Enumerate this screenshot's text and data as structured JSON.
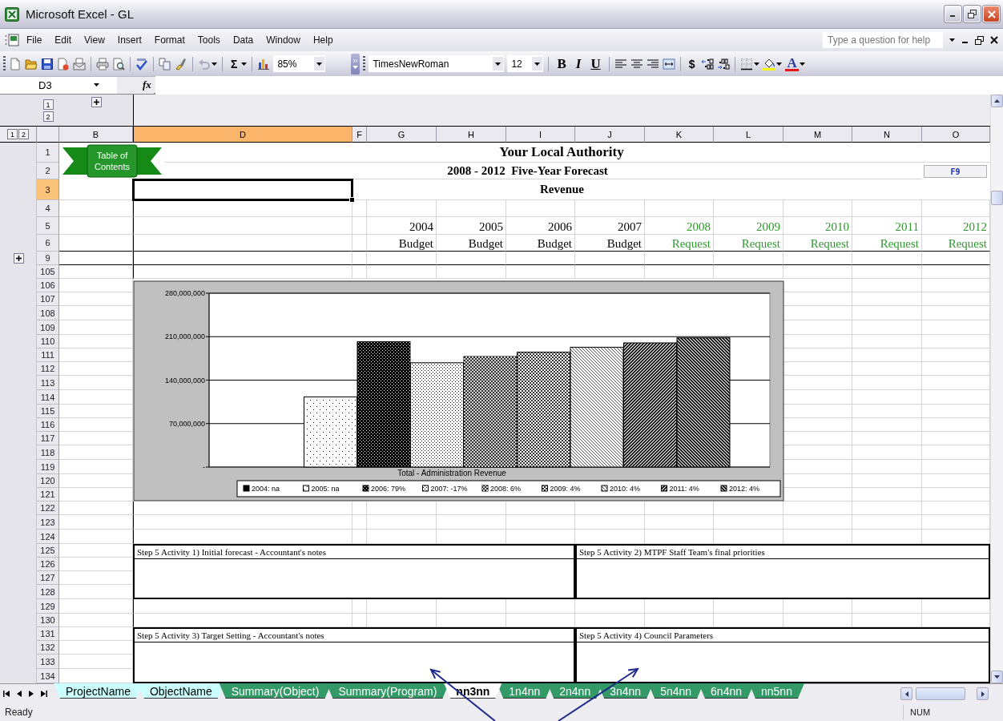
{
  "window": {
    "title": "Microsoft Excel - GL"
  },
  "menu": [
    "File",
    "Edit",
    "View",
    "Insert",
    "Format",
    "Tools",
    "Data",
    "Window",
    "Help"
  ],
  "help_box": {
    "placeholder": "Type a question for help"
  },
  "toolbar": {
    "zoom": "85%",
    "autosum": "Σ",
    "font": "TimesNewRoman",
    "size": "12",
    "bold": "B",
    "italic": "I",
    "underline": "U",
    "currency": "$",
    "font_color": "A"
  },
  "formula_bar": {
    "name_box": "D3",
    "function_label": "fx"
  },
  "outline": {
    "column_levels": [
      "1",
      "2"
    ],
    "row_levels": [
      "1",
      "2"
    ],
    "column_group_collapsed": true,
    "row_group_collapsed": true
  },
  "columns": [
    {
      "label": "B",
      "selected": false
    },
    {
      "label": "D",
      "selected": true
    },
    {
      "label": "F",
      "selected": false
    },
    {
      "label": "G",
      "selected": false
    },
    {
      "label": "H",
      "selected": false
    },
    {
      "label": "I",
      "selected": false
    },
    {
      "label": "J",
      "selected": false
    },
    {
      "label": "K",
      "selected": false
    },
    {
      "label": "L",
      "selected": false
    },
    {
      "label": "M",
      "selected": false
    },
    {
      "label": "N",
      "selected": false
    },
    {
      "label": "O",
      "selected": false
    }
  ],
  "rows": [
    {
      "label": "1",
      "selected": false
    },
    {
      "label": "2",
      "selected": false
    },
    {
      "label": "3",
      "selected": true
    },
    {
      "label": "4",
      "selected": false
    },
    {
      "label": "5",
      "selected": false
    },
    {
      "label": "6",
      "selected": false
    },
    {
      "label": "9",
      "selected": false
    },
    {
      "label": "105",
      "selected": false
    },
    {
      "label": "106",
      "selected": false
    },
    {
      "label": "107",
      "selected": false
    },
    {
      "label": "108",
      "selected": false
    },
    {
      "label": "109",
      "selected": false
    },
    {
      "label": "110",
      "selected": false
    },
    {
      "label": "111",
      "selected": false
    },
    {
      "label": "112",
      "selected": false
    },
    {
      "label": "113",
      "selected": false
    },
    {
      "label": "114",
      "selected": false
    },
    {
      "label": "115",
      "selected": false
    },
    {
      "label": "116",
      "selected": false
    },
    {
      "label": "117",
      "selected": false
    },
    {
      "label": "118",
      "selected": false
    },
    {
      "label": "119",
      "selected": false
    },
    {
      "label": "120",
      "selected": false
    },
    {
      "label": "121",
      "selected": false
    },
    {
      "label": "122",
      "selected": false
    },
    {
      "label": "123",
      "selected": false
    },
    {
      "label": "124",
      "selected": false
    },
    {
      "label": "125",
      "selected": false
    },
    {
      "label": "126",
      "selected": false
    },
    {
      "label": "127",
      "selected": false
    },
    {
      "label": "128",
      "selected": false
    },
    {
      "label": "129",
      "selected": false
    },
    {
      "label": "130",
      "selected": false
    },
    {
      "label": "131",
      "selected": false
    },
    {
      "label": "132",
      "selected": false
    },
    {
      "label": "133",
      "selected": false
    },
    {
      "label": "134",
      "selected": false
    }
  ],
  "toc_button": "Table of Contents",
  "f9_button": "F9",
  "header": {
    "title": "Your Local Authority",
    "subtitle": "2008 - 2012  Five-Year Forecast",
    "section": "Revenue"
  },
  "forecast": [
    {
      "year": "2004",
      "label": "Budget",
      "kind": "budget"
    },
    {
      "year": "2005",
      "label": "Budget",
      "kind": "budget"
    },
    {
      "year": "2006",
      "label": "Budget",
      "kind": "budget"
    },
    {
      "year": "2007",
      "label": "Budget",
      "kind": "budget"
    },
    {
      "year": "2008",
      "label": "Request",
      "kind": "request"
    },
    {
      "year": "2009",
      "label": "Request",
      "kind": "request"
    },
    {
      "year": "2010",
      "label": "Request",
      "kind": "request"
    },
    {
      "year": "2011",
      "label": "Request",
      "kind": "request"
    },
    {
      "year": "2012",
      "label": "Request",
      "kind": "request"
    }
  ],
  "chart": {
    "chart_data": {
      "type": "bar",
      "categories": [
        "Total - Administration Revenue"
      ],
      "ylim": [
        0,
        280000000
      ],
      "grid": true,
      "legend": true,
      "yticks": [
        {
          "value": 0,
          "label": "-"
        },
        {
          "value": 70000000,
          "label": "70,000,000"
        },
        {
          "value": 140000000,
          "label": "140,000,000"
        },
        {
          "value": 210000000,
          "label": "210,000,000"
        },
        {
          "value": 280000000,
          "label": "280,000,000"
        }
      ],
      "series": [
        {
          "name": "2004: na",
          "color": "#000000",
          "values": [
            null
          ]
        },
        {
          "name": "2005: na",
          "color": "#ffffff",
          "values": [
            113000000
          ]
        },
        {
          "name": "2006: 79%",
          "color": "#000000",
          "values": [
            202000000
          ]
        },
        {
          "name": "2007: -17%",
          "color": "#ffffff",
          "values": [
            168000000
          ]
        },
        {
          "name": "2008: 6%",
          "color": "#333333",
          "values": [
            178000000
          ]
        },
        {
          "name": "2009: 4%",
          "color": "#ffffff",
          "values": [
            185000000
          ]
        },
        {
          "name": "2010: 4%",
          "color": "#ffffff",
          "values": [
            193000000
          ]
        },
        {
          "name": "2011: 4%",
          "color": "#ffffff",
          "values": [
            200000000
          ]
        },
        {
          "name": "2012: 4%",
          "color": "#ffffff",
          "values": [
            208000000
          ]
        }
      ]
    }
  },
  "notes": [
    {
      "title": "Step 5 Activity 1)  Initial forecast - Accountant's notes"
    },
    {
      "title": "Step 5 Activity 2)  MTPF Staff Team's final priorities"
    },
    {
      "title": "Step 5 Activity 3)  Target Setting - Accountant's notes"
    },
    {
      "title": "Step 5 Activity 4)  Council Parameters"
    }
  ],
  "sheet_tabs": [
    {
      "label": "ProjectName",
      "color": "#ccffff",
      "selected": false
    },
    {
      "label": "ObjectName",
      "color": "#ccffff",
      "selected": false
    },
    {
      "label": "Summary(Object)",
      "color": "#339966",
      "selected": false
    },
    {
      "label": "Summary(Program)",
      "color": "#339966",
      "selected": false
    },
    {
      "label": "nn3nn",
      "color": "#ffffff",
      "selected": true
    },
    {
      "label": "1n4nn",
      "color": "#339966",
      "selected": false
    },
    {
      "label": "2n4nn",
      "color": "#339966",
      "selected": false
    },
    {
      "label": "3n4nn",
      "color": "#339966",
      "selected": false
    },
    {
      "label": "5n4nn",
      "color": "#339966",
      "selected": false
    },
    {
      "label": "6n4nn",
      "color": "#339966",
      "selected": false
    },
    {
      "label": "nn5nn",
      "color": "#339966",
      "selected": false
    }
  ],
  "status_bar": {
    "state": "Ready",
    "mode": "NUM"
  },
  "overlay_arrows": [
    {
      "kind": "arrow"
    },
    {
      "kind": "arrow"
    }
  ]
}
